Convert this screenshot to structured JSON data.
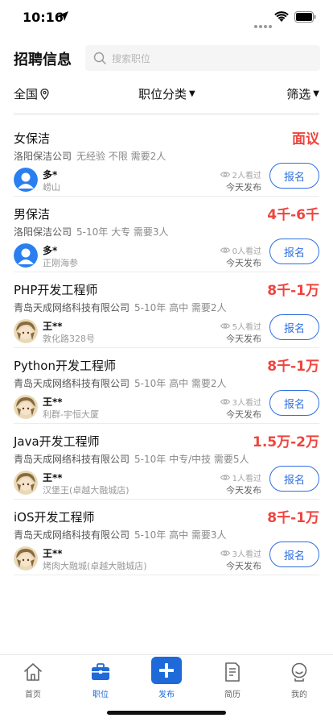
{
  "status": {
    "time": "10:16"
  },
  "header": {
    "title": "招聘信息",
    "search_placeholder": "搜索职位"
  },
  "filters": {
    "region": "全国",
    "category": "职位分类",
    "screen": "筛选"
  },
  "jobs": [
    {
      "title": "女保洁",
      "salary": "面议",
      "company": "洛阳保洁公司",
      "requirements": "无经验 不限 需要2人",
      "recruiter": "多*",
      "avatar": "default-avatar",
      "address": "崂山",
      "views": "2人看过",
      "posted": "今天发布",
      "apply": "报名"
    },
    {
      "title": "男保洁",
      "salary": "4千-6千",
      "company": "洛阳保洁公司",
      "requirements": "5-10年 大专 需要3人",
      "recruiter": "多*",
      "avatar": "default-avatar",
      "address": "正刚海参",
      "views": "0人看过",
      "posted": "今天发布",
      "apply": "报名"
    },
    {
      "title": "PHP开发工程师",
      "salary": "8千-1万",
      "company": "青岛天成网络科技有限公司",
      "requirements": "5-10年 高中 需要2人",
      "recruiter": "王**",
      "avatar": "anime-avatar",
      "address": "敦化路328号",
      "views": "5人看过",
      "posted": "今天发布",
      "apply": "报名"
    },
    {
      "title": "Python开发工程师",
      "salary": "8千-1万",
      "company": "青岛天成网络科技有限公司",
      "requirements": "5-10年 高中 需要2人",
      "recruiter": "王**",
      "avatar": "anime-avatar",
      "address": "利群-宇恒大厦",
      "views": "3人看过",
      "posted": "今天发布",
      "apply": "报名"
    },
    {
      "title": "Java开发工程师",
      "salary": "1.5万-2万",
      "company": "青岛天成网络科技有限公司",
      "requirements": "5-10年 中专/中技 需要5人",
      "recruiter": "王**",
      "avatar": "anime-avatar",
      "address": "汉堡王(卓越大融城店)",
      "views": "1人看过",
      "posted": "今天发布",
      "apply": "报名"
    },
    {
      "title": "iOS开发工程师",
      "salary": "8千-1万",
      "company": "青岛天成网络科技有限公司",
      "requirements": "5-10年 高中 需要3人",
      "recruiter": "王**",
      "avatar": "anime-avatar",
      "address": "烤肉大融城(卓越大融城店)",
      "views": "3人看过",
      "posted": "今天发布",
      "apply": "报名"
    }
  ],
  "tabs": [
    {
      "label": "首页",
      "icon": "home-icon",
      "active": false
    },
    {
      "label": "职位",
      "icon": "briefcase-icon",
      "active": true
    },
    {
      "label": "发布",
      "icon": "plus-icon",
      "active": false
    },
    {
      "label": "简历",
      "icon": "resume-icon",
      "active": false
    },
    {
      "label": "我的",
      "icon": "profile-icon",
      "active": false
    }
  ],
  "colors": {
    "accent": "#1f6ad8",
    "salary": "#f0433d",
    "apply_border": "#2f6fe0"
  }
}
